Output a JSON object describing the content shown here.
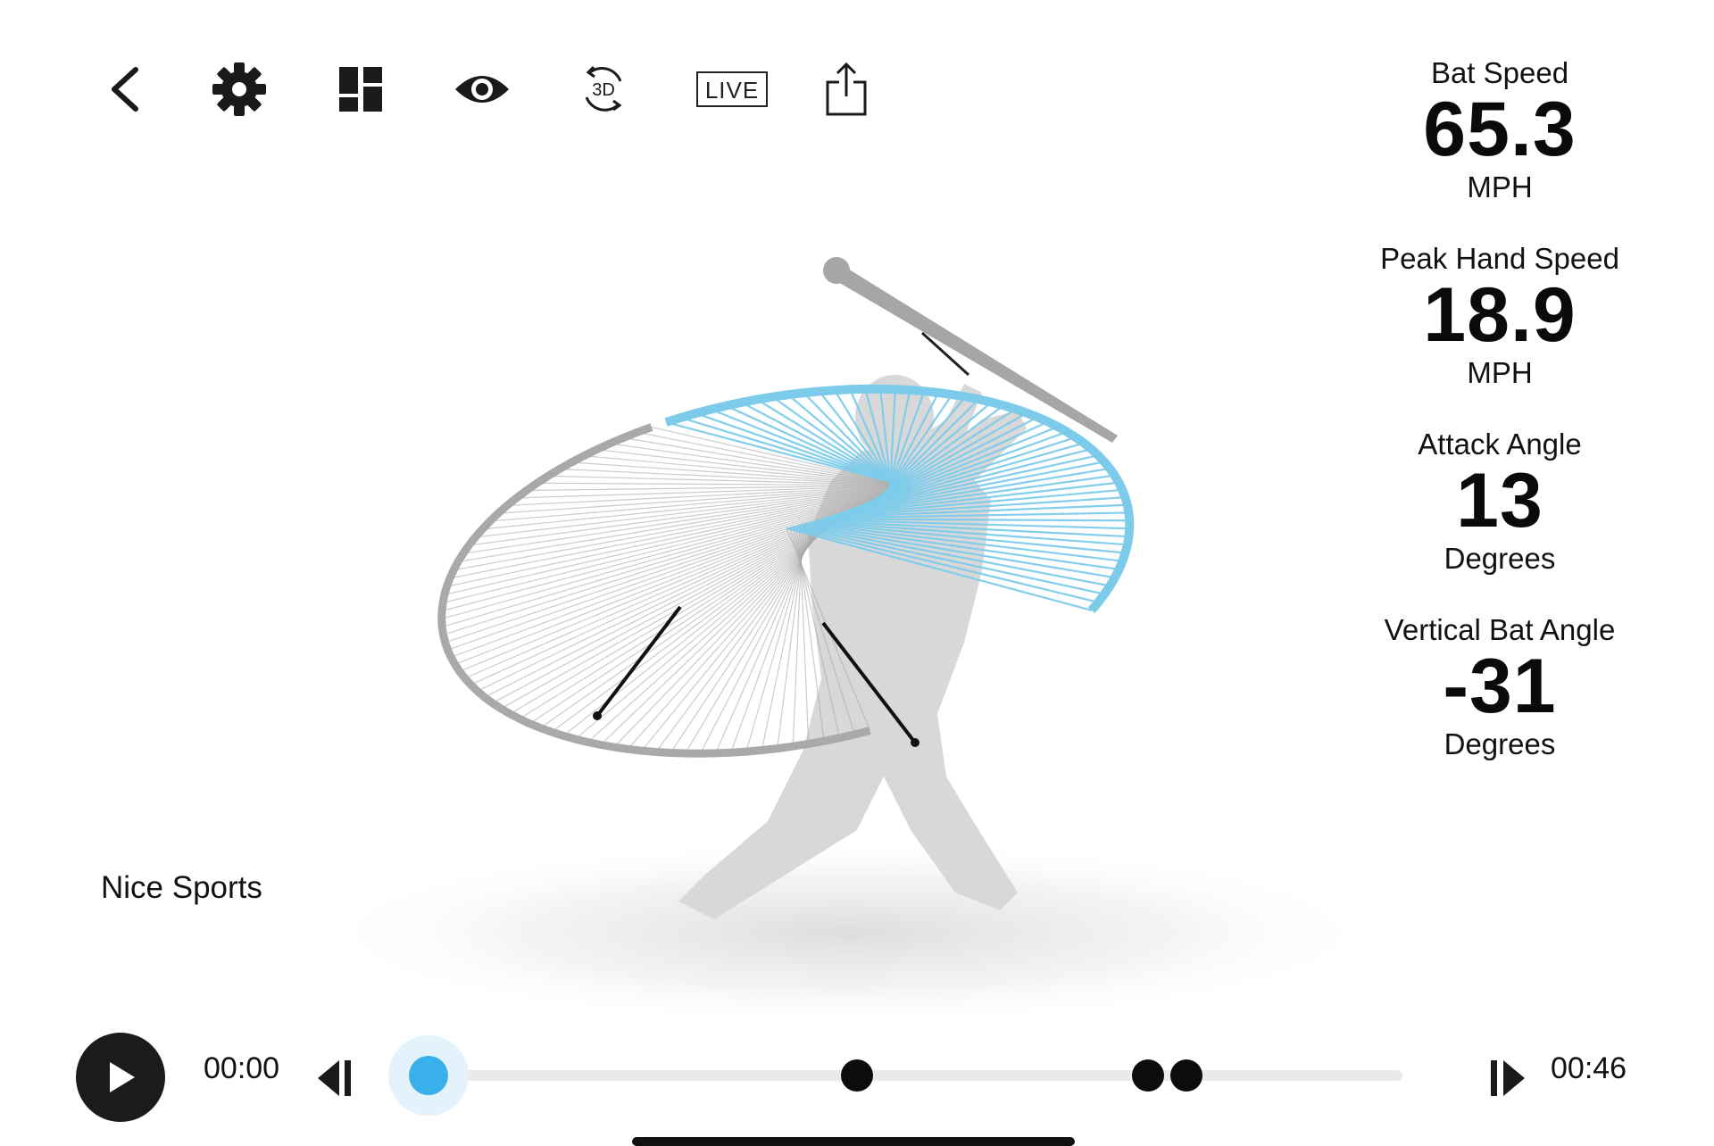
{
  "toolbar": {
    "icons": [
      "back-chevron-icon",
      "gear-icon",
      "layout-grid-icon",
      "eye-icon",
      "rotate-3d-icon",
      "live-badge",
      "share-icon"
    ],
    "three_d_label": "3D",
    "live_label": "LIVE"
  },
  "metrics": [
    {
      "label": "Bat Speed",
      "value": "65.3",
      "unit": "MPH"
    },
    {
      "label": "Peak Hand Speed",
      "value": "18.9",
      "unit": "MPH"
    },
    {
      "label": "Attack Angle",
      "value": "13",
      "unit": "Degrees"
    },
    {
      "label": "Vertical Bat Angle",
      "value": "-31",
      "unit": "Degrees"
    }
  ],
  "scene": {
    "brand": "Nice Sports",
    "colors": {
      "swing_path": "#7ccbeb",
      "swing_path_early": "#a9a9a9",
      "silhouette": "#d6d6d6",
      "bat": "#a6a6a6"
    }
  },
  "playback": {
    "current_time": "00:00",
    "total_time": "00:46",
    "progress": 0,
    "accent_color": "#3ab0ea",
    "event_markers": 3
  }
}
